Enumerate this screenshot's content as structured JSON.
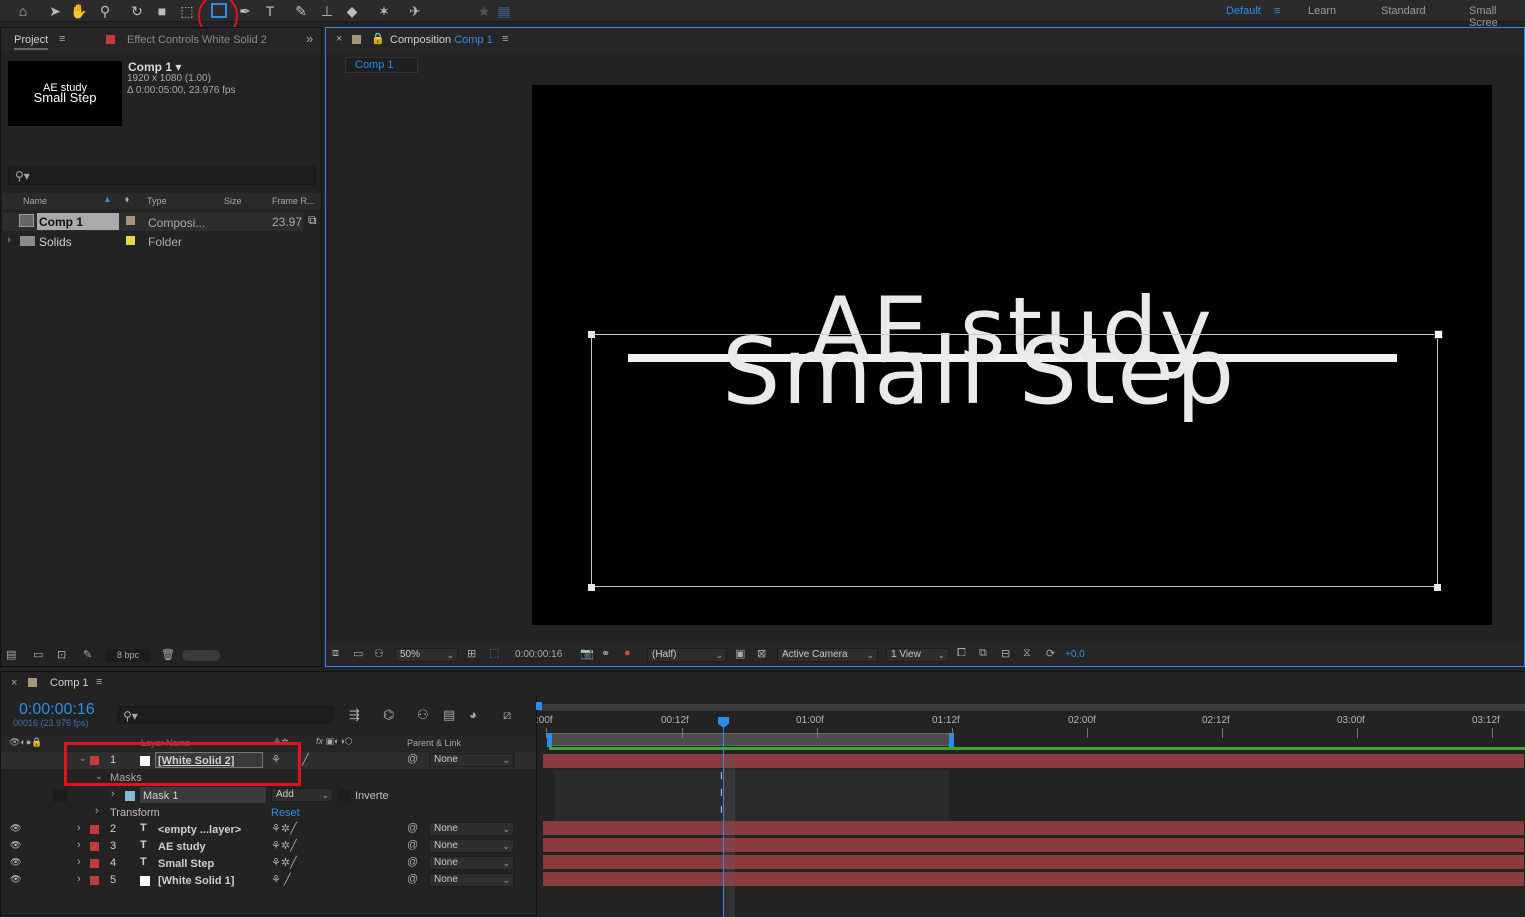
{
  "toolbar": {
    "workspaces": [
      "Default",
      "Learn",
      "Standard",
      "Small Scree"
    ],
    "active_workspace": "Default"
  },
  "project_panel": {
    "tab_project": "Project",
    "tab_effect_controls": "Effect Controls",
    "tab_effect_target": "White Solid 2",
    "preview_text_line1": "AE study",
    "preview_text_line2": "Small Step",
    "comp_name": "Comp 1",
    "comp_resolution": "1920 x 1080 (1.00)",
    "comp_duration": "Δ 0:00:05:00, 23.976 fps",
    "columns": [
      "Name",
      "Type",
      "Size",
      "Frame R..."
    ],
    "items": [
      {
        "name": "Comp 1",
        "type": "Composi...",
        "frame_rate": "23.97",
        "color": "#a59678"
      },
      {
        "name": "Solids",
        "type": "Folder",
        "frame_rate": "",
        "color": "#e8d54a"
      }
    ],
    "bpc": "8 bpc"
  },
  "composition_panel": {
    "title_prefix": "Composition",
    "title_comp": "Comp 1",
    "comp_tab": "Comp 1",
    "canvas_text_top": "AE study",
    "canvas_text_bottom": "Small Step",
    "zoom": "50%",
    "timecode": "0:00:00:16",
    "resolution": "(Half)",
    "camera": "Active Camera",
    "views": "1 View",
    "exposure": "+0.0"
  },
  "timeline": {
    "tab": "Comp 1",
    "current_time": "0:00:00:16",
    "frame_info": "00016 (23.976 fps)",
    "col_layer_name": "Layer Name",
    "col_parent": "Parent & Link",
    "ruler_labels": [
      ":00f",
      "00:12f",
      "01:00f",
      "01:12f",
      "02:00f",
      "02:12f",
      "03:00f",
      "03:12f"
    ],
    "layers": [
      {
        "num": "1",
        "name": "[White Solid 2]",
        "type": "solid",
        "parent": "None"
      },
      {
        "num": "2",
        "name": "<empty ...layer>",
        "type": "text",
        "parent": "None"
      },
      {
        "num": "3",
        "name": "AE study",
        "type": "text",
        "parent": "None"
      },
      {
        "num": "4",
        "name": "Small Step",
        "type": "text",
        "parent": "None"
      },
      {
        "num": "5",
        "name": "[White Solid 1]",
        "type": "solid",
        "parent": "None"
      }
    ],
    "masks_label": "Masks",
    "mask_name": "Mask 1",
    "mask_mode": "Add",
    "inverted_label": "Inverte",
    "transform_label": "Transform",
    "reset_label": "Reset"
  },
  "colors": {
    "accent": "#2d8ceb",
    "label_red": "#c3393c",
    "bar_red": "#8b3b3e",
    "annotation_red": "#e0141c"
  }
}
